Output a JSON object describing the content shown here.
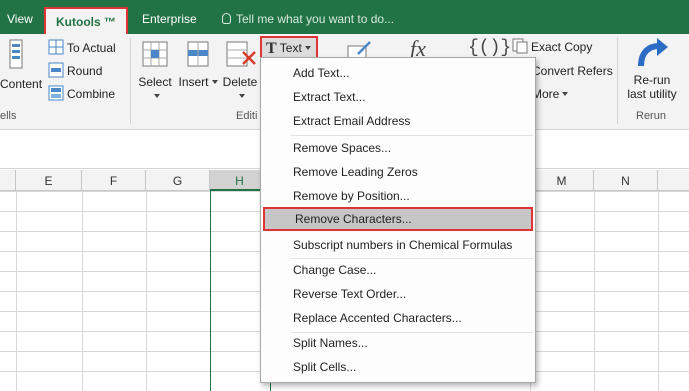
{
  "tabs": {
    "view": "View",
    "kutools": "Kutools ™",
    "enterprise": "Enterprise",
    "tell_me": "Tell me what you want to do..."
  },
  "ribbon": {
    "content": "Content",
    "cells_group": "ells",
    "to_actual": "To Actual",
    "round": "Round",
    "combine": "Combine",
    "select": "Select",
    "insert": "Insert",
    "delete": "Delete",
    "editing_group": "Editi",
    "text_button": "Text",
    "exact_copy": "Exact Copy",
    "convert_refers": "Convert Refers",
    "more": "More",
    "rerun_line1": "Re-run",
    "rerun_line2": "last utility",
    "rerun_group": "Rerun",
    "accent_color": "#217346",
    "highlight_color": "#e03434"
  },
  "columns": [
    "E",
    "F",
    "G",
    "H",
    "M",
    "N"
  ],
  "selected_column": "H",
  "menu": {
    "items": [
      "Add Text...",
      "Extract Text...",
      "Extract Email Address",
      "Remove Spaces...",
      "Remove Leading Zeros",
      "Remove by Position...",
      "Remove Characters...",
      "Subscript numbers in Chemical Formulas",
      "Change Case...",
      "Reverse Text Order...",
      "Replace Accented Characters...",
      "Split Names...",
      "Split Cells..."
    ],
    "highlighted_item": "Remove Characters..."
  }
}
